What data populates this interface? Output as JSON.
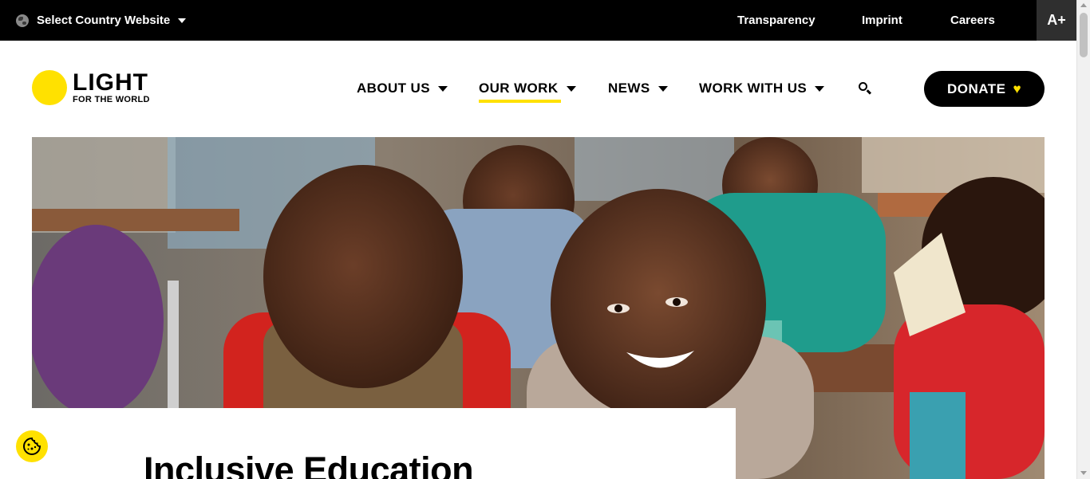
{
  "topbar": {
    "country_label": "Select Country Website",
    "links": [
      {
        "label": "Transparency"
      },
      {
        "label": "Imprint"
      },
      {
        "label": "Careers"
      }
    ],
    "font_size_button": "A+"
  },
  "header": {
    "logo_main": "LIGHT",
    "logo_sub": "FOR THE WORLD",
    "nav": [
      {
        "label": "ABOUT US",
        "active": false
      },
      {
        "label": "OUR WORK",
        "active": true
      },
      {
        "label": "NEWS",
        "active": false
      },
      {
        "label": "WORK WITH US",
        "active": false
      }
    ],
    "donate_label": "DONATE",
    "accent_color": "#ffe100"
  },
  "hero": {
    "image_alt": "Children smiling in a classroom",
    "title": "Inclusive Education"
  },
  "icons": {
    "globe": "globe-icon",
    "search": "search-icon",
    "heart": "heart-icon",
    "cookie": "cookie-icon"
  }
}
